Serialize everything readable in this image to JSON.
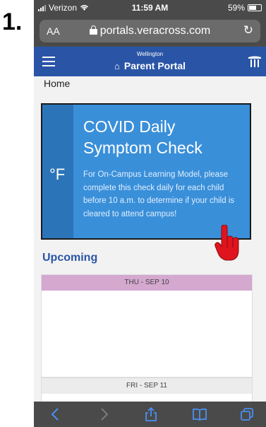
{
  "step_label": "1.",
  "status_bar": {
    "carrier": "Verizon",
    "time": "11:59 AM",
    "battery": "59%"
  },
  "browser": {
    "text_size_button": "AA",
    "url": "portals.veracross.com",
    "reload_icon": "reload-icon"
  },
  "portal_header": {
    "school": "Wellington",
    "title": "Parent Portal"
  },
  "breadcrumb": "Home",
  "covid_card": {
    "icon_text": "°F",
    "title": "COVID Daily Symptom Check",
    "description": "For On-Campus Learning Model, please complete this check daily for each child before 10 a.m. to determine if your child is cleared to attend campus!"
  },
  "upcoming": {
    "heading": "Upcoming",
    "days": [
      {
        "label": "THU - SEP 10"
      },
      {
        "label": "FRI - SEP 11"
      }
    ]
  },
  "colors": {
    "header_blue": "#2a55a7",
    "card_blue": "#3a8fd9",
    "card_strip": "#2c74b8",
    "thursday_band": "#d4a8cf",
    "pointer_red": "#e0141e"
  },
  "toolbar": {
    "icons": [
      "back-icon",
      "forward-icon",
      "share-icon",
      "bookmarks-icon",
      "tabs-icon"
    ]
  }
}
